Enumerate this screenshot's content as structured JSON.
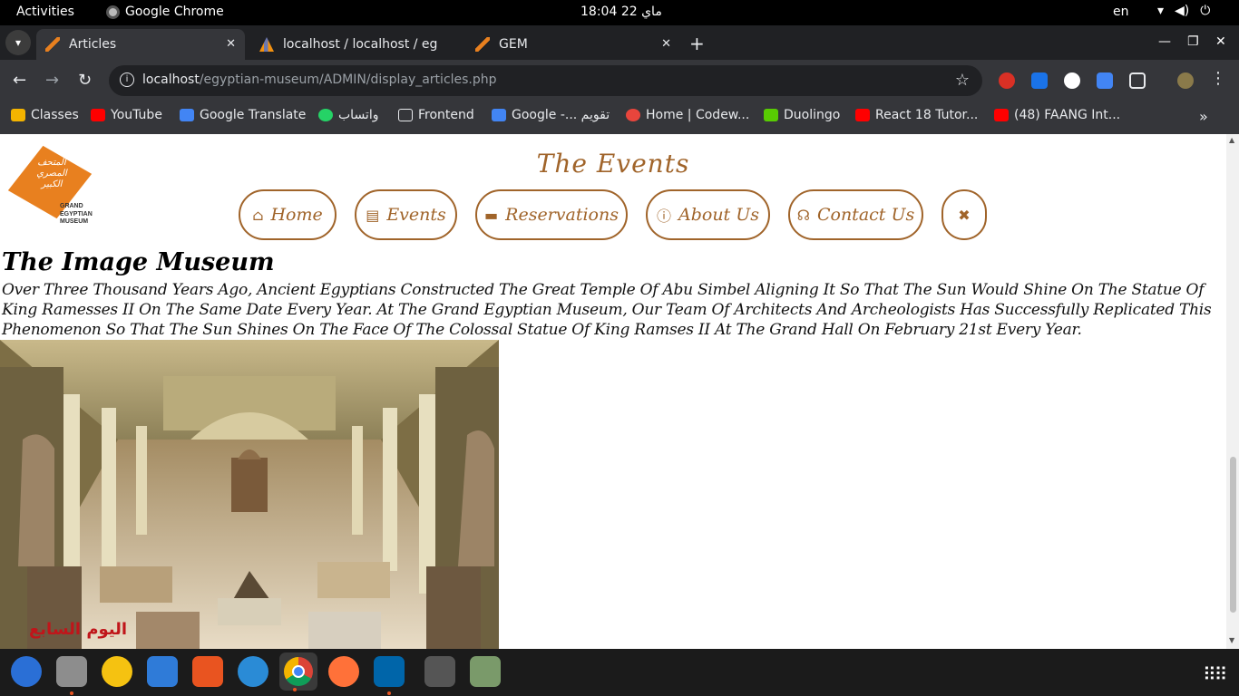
{
  "topbar": {
    "activities": "Activities",
    "app_name": "Google Chrome",
    "clock": "ماي 22  18:04",
    "lang": "en"
  },
  "tabs": [
    {
      "title": "Articles",
      "active": true
    },
    {
      "title": "localhost / localhost / eg",
      "active": false
    },
    {
      "title": "GEM",
      "active": false
    }
  ],
  "address": {
    "host": "localhost",
    "path": "/egyptian-museum/ADMIN/display_articles.php"
  },
  "bookmarks": [
    {
      "label": "Classes",
      "color": "#f4b400"
    },
    {
      "label": "YouTube",
      "color": "#ff0000"
    },
    {
      "label": "Google Translate",
      "color": "#4285f4"
    },
    {
      "label": "واتساب",
      "color": "#25d366"
    },
    {
      "label": "Frontend",
      "color": "#9aa0a6"
    },
    {
      "label": "Google -... تقويم",
      "color": "#4285f4"
    },
    {
      "label": "Home | Codew...",
      "color": "#e8453c"
    },
    {
      "label": "Duolingo",
      "color": "#58cc02"
    },
    {
      "label": "React 18 Tutor...",
      "color": "#ff0000"
    },
    {
      "label": "(48) FAANG Int...",
      "color": "#ff0000"
    }
  ],
  "page": {
    "logo_arabic": "المتحف المصري الكبير",
    "logo_english": [
      "GRAND",
      "EGYPTIAN",
      "MUSEUM"
    ],
    "heading": "The Events",
    "nav": [
      {
        "label": "Home",
        "icon": "home-icon"
      },
      {
        "label": "Events",
        "icon": "newspaper-icon"
      },
      {
        "label": "Reservations",
        "icon": "ticket-icon"
      },
      {
        "label": "About Us",
        "icon": "info-icon"
      },
      {
        "label": "Contact Us",
        "icon": "headset-icon"
      },
      {
        "label": "",
        "icon": "tools-icon"
      }
    ],
    "article": {
      "title": "The Image Museum",
      "body": "Over Three Thousand Years Ago, Ancient Egyptians Constructed The Great Temple Of Abu Simbel Aligning It So That The Sun Would Shine On The Statue Of King Ramesses II On The Same Date Every Year. At The Grand Egyptian Museum, Our Team Of Architects And Archeologists Has Successfully Replicated This Phenomenon So That The Sun Shines On The Face Of The Colossal Statue Of King Ramses II At The Grand Hall On February 21st Every Year.",
      "image_watermark": "اليوم السابع"
    }
  },
  "colors": {
    "accent": "#a0642a",
    "logo_orange": "#e8801f"
  }
}
